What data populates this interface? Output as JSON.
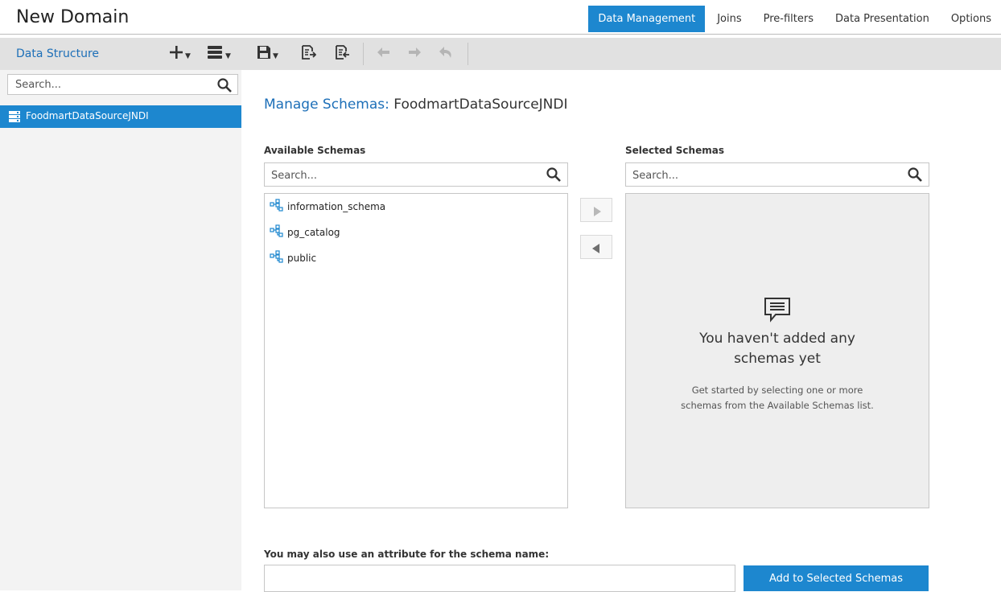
{
  "app": {
    "title": "New Domain"
  },
  "tabs": [
    "Data Management",
    "Joins",
    "Pre-filters",
    "Data Presentation",
    "Options"
  ],
  "active_tab": "Data Management",
  "sidebar": {
    "title": "Data Structure",
    "search_placeholder": "Search...",
    "items": [
      {
        "label": "FoodmartDataSourceJNDI",
        "icon": "datasource-icon",
        "selected": true
      }
    ],
    "toolbar_icons": [
      "add-icon",
      "layers-icon"
    ]
  },
  "toolbar": {
    "icons": [
      "save-icon",
      "export-icon",
      "import-icon",
      "undo-icon",
      "redo-icon",
      "undo-all-icon"
    ]
  },
  "main": {
    "title_prefix": "Manage Schemas:",
    "title_name": "FoodmartDataSourceJNDI",
    "available": {
      "label": "Available Schemas",
      "search_placeholder": "Search...",
      "items": [
        "information_schema",
        "pg_catalog",
        "public"
      ]
    },
    "selected": {
      "label": "Selected Schemas",
      "search_placeholder": "Search...",
      "empty_title": "You haven't added any schemas yet",
      "empty_desc": "Get started by selecting one or more schemas from the Available Schemas list."
    },
    "attribute": {
      "label": "You may also use an attribute for the schema name:",
      "value": ""
    },
    "add_button": "Add to Selected Schemas"
  },
  "colors": {
    "accent": "#1d87cf",
    "link": "#1d6fb8",
    "toolbar_bg": "#e1e1e1",
    "sidebar_bg": "#f3f3f3"
  }
}
